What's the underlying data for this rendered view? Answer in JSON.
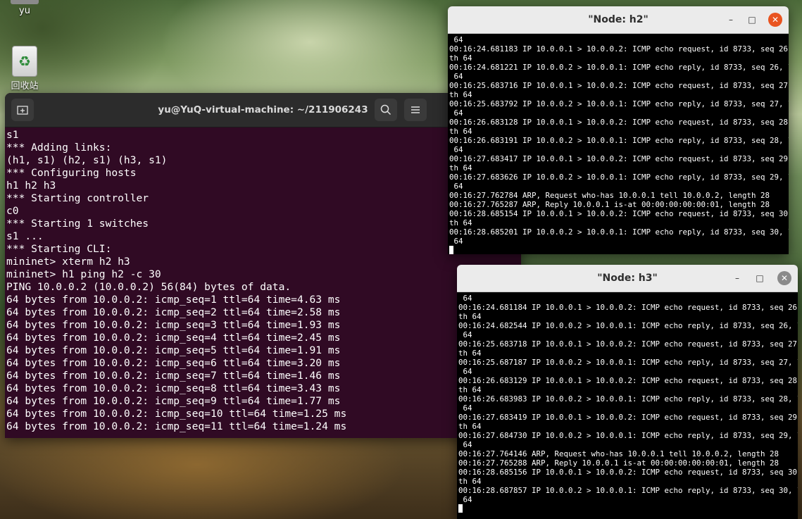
{
  "desktop": {
    "home_label": "yu",
    "trash_label": "回收站",
    "trash_icon": "recycle-icon"
  },
  "terminal": {
    "title": "yu@YuQ-virtual-machine: ~/211906243",
    "new_tab_icon": "new-tab-icon",
    "search_icon": "search-icon",
    "menu_icon": "hamburger-menu-icon",
    "lines": [
      "s1",
      "*** Adding links:",
      "(h1, s1) (h2, s1) (h3, s1)",
      "*** Configuring hosts",
      "h1 h2 h3",
      "*** Starting controller",
      "c0",
      "*** Starting 1 switches",
      "s1 ...",
      "*** Starting CLI:",
      "mininet> xterm h2 h3",
      "mininet> h1 ping h2 -c 30",
      "PING 10.0.0.2 (10.0.0.2) 56(84) bytes of data.",
      "64 bytes from 10.0.0.2: icmp_seq=1 ttl=64 time=4.63 ms",
      "64 bytes from 10.0.0.2: icmp_seq=2 ttl=64 time=2.58 ms",
      "64 bytes from 10.0.0.2: icmp_seq=3 ttl=64 time=1.93 ms",
      "64 bytes from 10.0.0.2: icmp_seq=4 ttl=64 time=2.45 ms",
      "64 bytes from 10.0.0.2: icmp_seq=5 ttl=64 time=1.91 ms",
      "64 bytes from 10.0.0.2: icmp_seq=6 ttl=64 time=3.20 ms",
      "64 bytes from 10.0.0.2: icmp_seq=7 ttl=64 time=1.46 ms",
      "64 bytes from 10.0.0.2: icmp_seq=8 ttl=64 time=3.43 ms",
      "64 bytes from 10.0.0.2: icmp_seq=9 ttl=64 time=1.77 ms",
      "64 bytes from 10.0.0.2: icmp_seq=10 ttl=64 time=1.25 ms",
      "64 bytes from 10.0.0.2: icmp_seq=11 ttl=64 time=1.24 ms"
    ]
  },
  "xterm_h2": {
    "title": "\"Node: h2\"",
    "lines": [
      " 64",
      "00:16:24.681183 IP 10.0.0.1 > 10.0.0.2: ICMP echo request, id 8733, seq 26, leng",
      "th 64",
      "00:16:24.681221 IP 10.0.0.2 > 10.0.0.1: ICMP echo reply, id 8733, seq 26, length",
      " 64",
      "00:16:25.683716 IP 10.0.0.1 > 10.0.0.2: ICMP echo request, id 8733, seq 27, leng",
      "th 64",
      "00:16:25.683792 IP 10.0.0.2 > 10.0.0.1: ICMP echo reply, id 8733, seq 27, length",
      " 64",
      "00:16:26.683128 IP 10.0.0.1 > 10.0.0.2: ICMP echo request, id 8733, seq 28, leng",
      "th 64",
      "00:16:26.683191 IP 10.0.0.2 > 10.0.0.1: ICMP echo reply, id 8733, seq 28, length",
      " 64",
      "00:16:27.683417 IP 10.0.0.1 > 10.0.0.2: ICMP echo request, id 8733, seq 29, leng",
      "th 64",
      "00:16:27.683626 IP 10.0.0.2 > 10.0.0.1: ICMP echo reply, id 8733, seq 29, length",
      " 64",
      "00:16:27.762784 ARP, Request who-has 10.0.0.1 tell 10.0.0.2, length 28",
      "00:16:27.765287 ARP, Reply 10.0.0.1 is-at 00:00:00:00:00:01, length 28",
      "00:16:28.685154 IP 10.0.0.1 > 10.0.0.2: ICMP echo request, id 8733, seq 30, leng",
      "th 64",
      "00:16:28.685201 IP 10.0.0.2 > 10.0.0.1: ICMP echo reply, id 8733, seq 30, length",
      " 64"
    ]
  },
  "xterm_h3": {
    "title": "\"Node: h3\"",
    "lines": [
      " 64",
      "00:16:24.681184 IP 10.0.0.1 > 10.0.0.2: ICMP echo request, id 8733, seq 26, leng",
      "th 64",
      "00:16:24.682544 IP 10.0.0.2 > 10.0.0.1: ICMP echo reply, id 8733, seq 26, length",
      " 64",
      "00:16:25.683718 IP 10.0.0.1 > 10.0.0.2: ICMP echo request, id 8733, seq 27, leng",
      "th 64",
      "00:16:25.687187 IP 10.0.0.2 > 10.0.0.1: ICMP echo reply, id 8733, seq 27, length",
      " 64",
      "00:16:26.683129 IP 10.0.0.1 > 10.0.0.2: ICMP echo request, id 8733, seq 28, leng",
      "th 64",
      "00:16:26.683983 IP 10.0.0.2 > 10.0.0.1: ICMP echo reply, id 8733, seq 28, length",
      " 64",
      "00:16:27.683419 IP 10.0.0.1 > 10.0.0.2: ICMP echo request, id 8733, seq 29, leng",
      "th 64",
      "00:16:27.684730 IP 10.0.0.2 > 10.0.0.1: ICMP echo reply, id 8733, seq 29, length",
      " 64",
      "00:16:27.764146 ARP, Request who-has 10.0.0.1 tell 10.0.0.2, length 28",
      "00:16:27.765288 ARP, Reply 10.0.0.1 is-at 00:00:00:00:00:01, length 28",
      "00:16:28.685156 IP 10.0.0.1 > 10.0.0.2: ICMP echo request, id 8733, seq 30, leng",
      "th 64",
      "00:16:28.687857 IP 10.0.0.2 > 10.0.0.1: ICMP echo reply, id 8733, seq 30, length",
      " 64"
    ]
  },
  "window_controls": {
    "minimize": "–",
    "maximize": "□",
    "close": "✕"
  },
  "colors": {
    "terminal_bg": "#300a24",
    "header_bg": "#2c2c2c",
    "close_accent": "#e95420",
    "xterm_bg": "#000000"
  }
}
